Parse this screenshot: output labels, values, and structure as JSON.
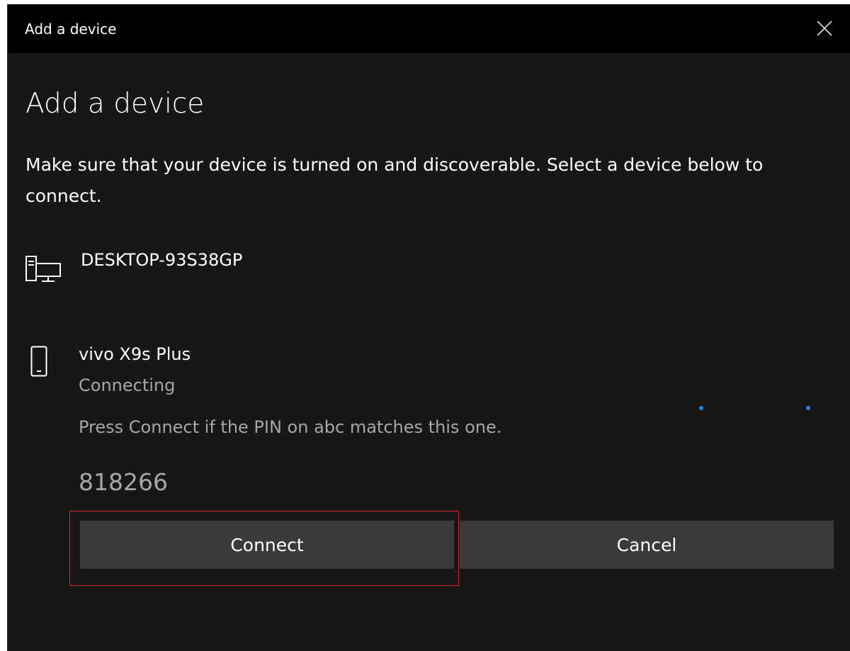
{
  "window": {
    "title": "Add a device",
    "close_icon": "close-icon"
  },
  "page": {
    "heading": "Add a device",
    "instructions": "Make sure that your device is turned on and discoverable. Select a device below to connect."
  },
  "devices": [
    {
      "name": "DESKTOP-93S38GP",
      "icon": "desktop-computer-icon"
    },
    {
      "name": "vivo X9s Plus",
      "icon": "phone-icon",
      "status": "Connecting"
    }
  ],
  "pairing": {
    "prompt": "Press Connect if the PIN on abc matches this one.",
    "pin": "818266"
  },
  "buttons": {
    "connect_label": "Connect",
    "cancel_label": "Cancel"
  },
  "colors": {
    "background": "#171717",
    "titlebar": "#000000",
    "button": "#3a3a3a",
    "accent_dots": "#1e86e3",
    "highlight": "#d8232a"
  }
}
